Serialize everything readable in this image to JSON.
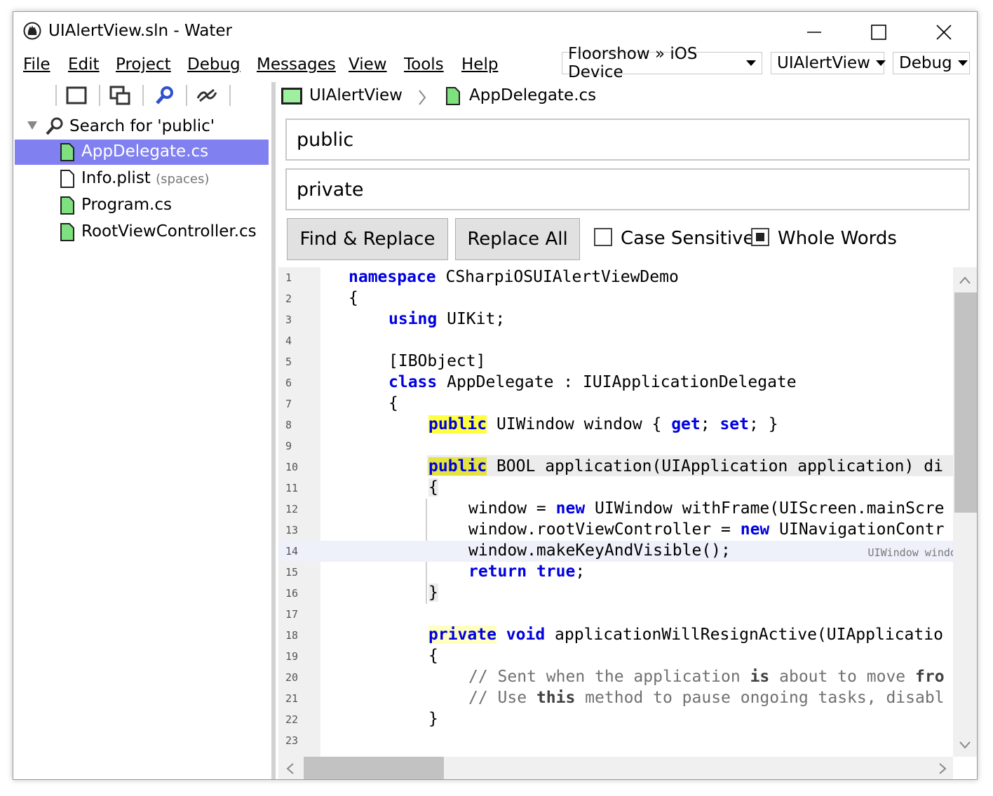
{
  "window": {
    "title": "UIAlertView.sln - Water"
  },
  "menu": {
    "file": "File",
    "edit": "Edit",
    "project": "Project",
    "debug": "Debug",
    "messages": "Messages",
    "view": "View",
    "tools": "Tools",
    "help": "Help"
  },
  "toolbar": {
    "device": "Floorshow » iOS Device",
    "target": "UIAlertView",
    "config": "Debug"
  },
  "sidebar": {
    "search_label": "Search for 'public'",
    "files": [
      {
        "name": "AppDelegate.cs",
        "note": ""
      },
      {
        "name": "Info.plist",
        "note": "(spaces)"
      },
      {
        "name": "Program.cs",
        "note": ""
      },
      {
        "name": "RootViewController.cs",
        "note": ""
      }
    ]
  },
  "breadcrumb": {
    "project": "UIAlertView",
    "file": "AppDelegate.cs"
  },
  "find": {
    "find_value": "public",
    "replace_value": "private",
    "find_replace_label": "Find & Replace",
    "replace_all_label": "Replace All",
    "case_sensitive_label": "Case Sensitive",
    "case_sensitive": false,
    "whole_words_label": "Whole Words",
    "whole_words": true
  },
  "editor": {
    "line_numbers": [
      "1",
      "2",
      "3",
      "4",
      "5",
      "6",
      "7",
      "8",
      "9",
      "10",
      "11",
      "12",
      "13",
      "14",
      "15",
      "16",
      "17",
      "18",
      "19",
      "20",
      "21",
      "22",
      "23"
    ],
    "current_line": 14,
    "inline_hint": "UIWindow window",
    "tokens": {
      "namespace": "namespace",
      "ns_name": "CSharpiOSUIAlertViewDemo",
      "using": "using",
      "uikit": "UIKit;",
      "attr": "[IBObject]",
      "class": "class",
      "class_rest": "AppDelegate : IUIApplicationDelegate",
      "public": "public",
      "l8_a": "UIWindow window { ",
      "get": "get",
      "semi_sp": "; ",
      "set": "set",
      "l8_b": "; }",
      "l10": "BOOL application(UIApplication application) di",
      "l12_a": "window = ",
      "new": "new",
      "l12_b": "UIWindow withFrame(UIScreen.mainScre",
      "l13_a": "window.rootViewController = ",
      "l13_b": "UINavigationContr",
      "l14": "window.makeKeyAndVisible();",
      "return": "return",
      "true": "true",
      "semi": ";",
      "private": "private",
      "void": "void",
      "l18": "applicationWillResignActive(UIApplicatio",
      "c20_a": "// Sent when the application ",
      "is": "is",
      "c20_b": " about to move ",
      "fr": "fro",
      "c21_a": "// Use ",
      "this": "this",
      "c21_b": " method to pause ongoing tasks, disabl",
      "open": "{",
      "close": "}"
    }
  },
  "colors": {
    "keyword": "#0000e0",
    "comment": "#707070",
    "highlight": "#ffff40",
    "selection": "#8080f0",
    "file_icon": "#7ee07e"
  }
}
